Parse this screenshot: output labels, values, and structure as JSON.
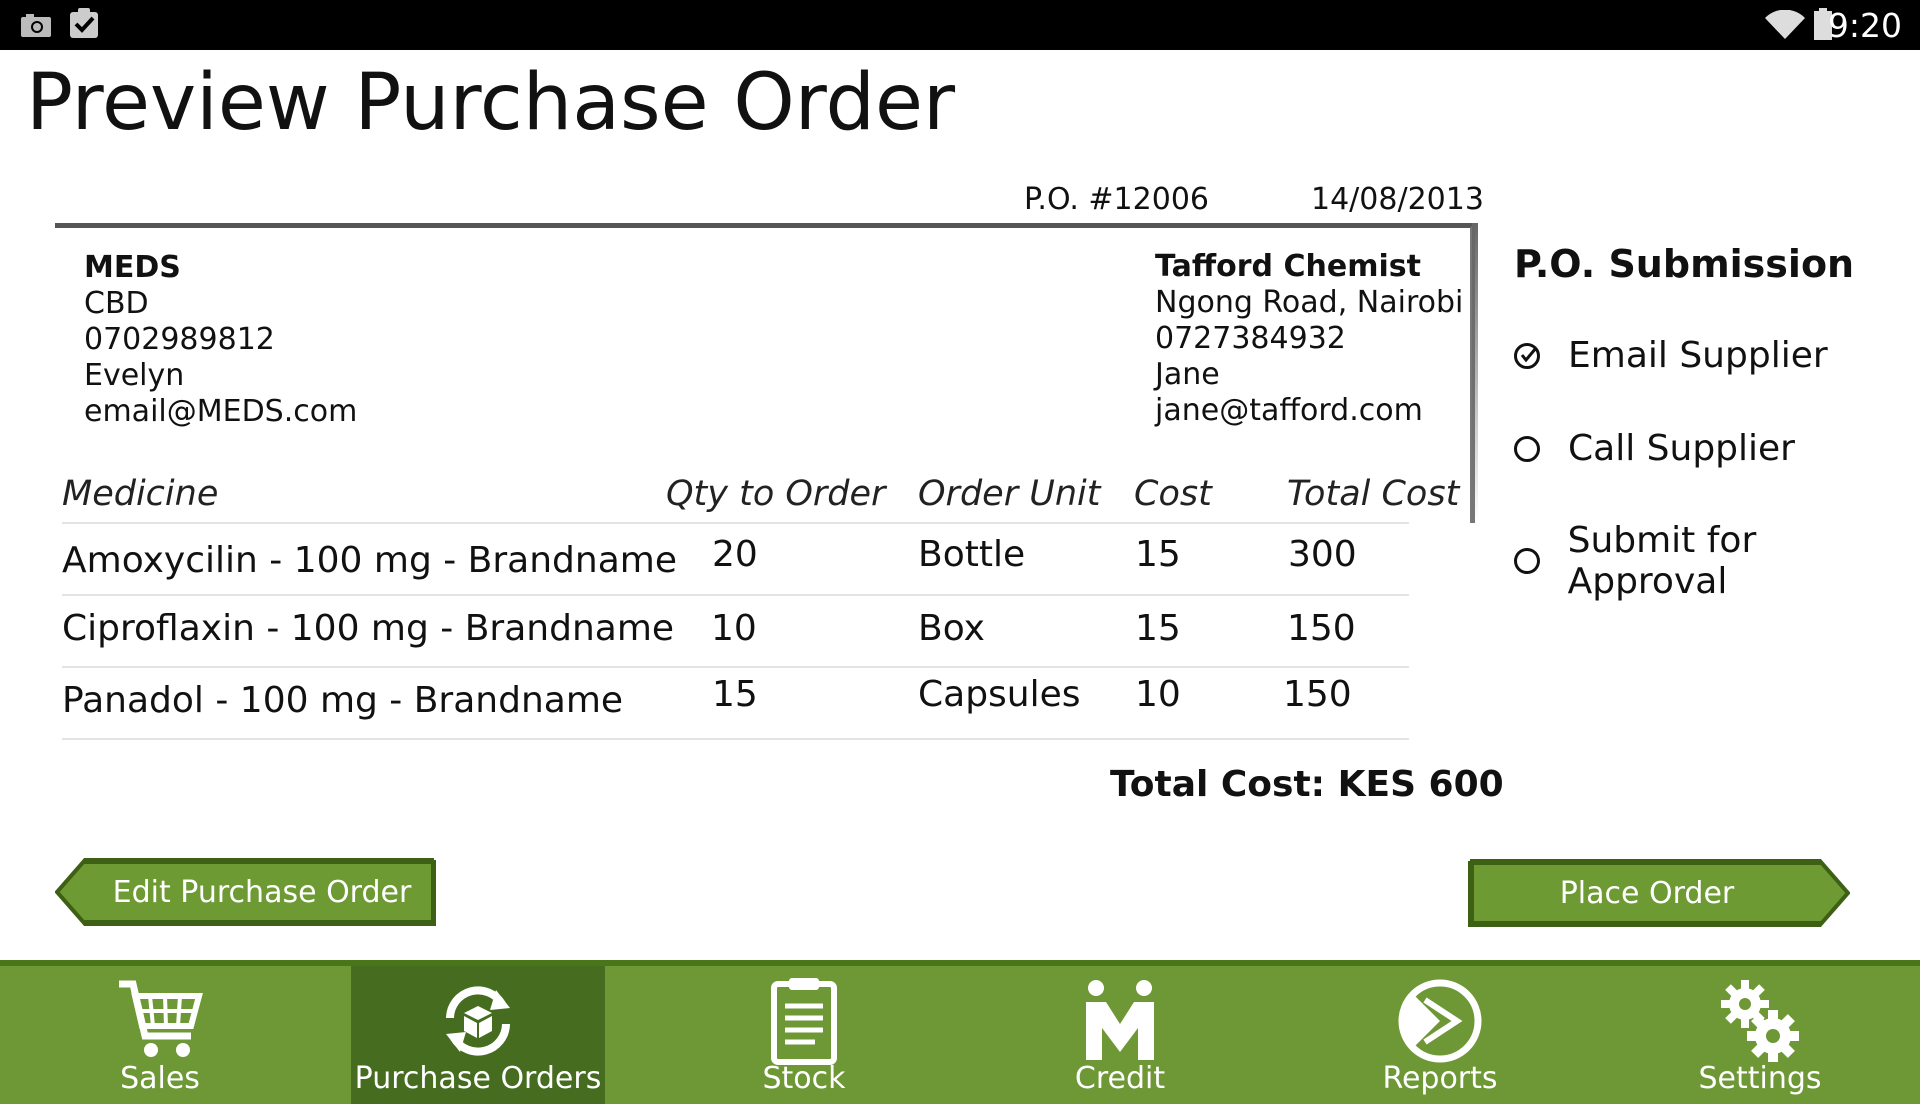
{
  "status_bar": {
    "time": "9:20",
    "icons": [
      "camera-icon",
      "clipboard-check-icon",
      "wifi-icon",
      "battery-icon"
    ]
  },
  "page": {
    "title": "Preview Purchase Order"
  },
  "order": {
    "po_number": "P.O. #12006",
    "date": "14/08/2013"
  },
  "buyer": {
    "name": "MEDS",
    "location": "CBD",
    "phone": "0702989812",
    "contact": "Evelyn",
    "email": "email@MEDS.com"
  },
  "supplier": {
    "name": "Tafford Chemist",
    "location": "Ngong Road, Nairobi",
    "phone": "0727384932",
    "contact": "Jane",
    "email": "jane@tafford.com"
  },
  "table": {
    "columns": [
      "Medicine",
      "Qty to Order",
      "Order Unit",
      "Cost",
      "Total Cost"
    ],
    "rows": [
      {
        "medicine": "Amoxycilin - 100 mg - Brandname",
        "qty": "20",
        "unit": "Bottle",
        "cost": "15",
        "total": "300"
      },
      {
        "medicine": "Ciproflaxin - 100 mg - Brandname",
        "qty": "10",
        "unit": "Box",
        "cost": "15",
        "total": "150"
      },
      {
        "medicine": "Panadol - 100 mg - Brandname",
        "qty": "15",
        "unit": "Capsules",
        "cost": "10",
        "total": "150"
      }
    ],
    "total_label": "Total Cost: KES 600"
  },
  "submission": {
    "title": "P.O. Submission",
    "options": [
      {
        "label": "Email Supplier",
        "selected": true
      },
      {
        "label": "Call Supplier",
        "selected": false
      },
      {
        "label": "Submit for Approval",
        "selected": false
      }
    ]
  },
  "actions": {
    "edit_label": "Edit Purchase Order",
    "place_label": "Place Order"
  },
  "nav": {
    "items": [
      {
        "label": "Sales",
        "icon": "cart-icon"
      },
      {
        "label": "Purchase Orders",
        "icon": "purchase-orders-icon",
        "active": true
      },
      {
        "label": "Stock",
        "icon": "clipboard-icon"
      },
      {
        "label": "Credit",
        "icon": "handshake-icon"
      },
      {
        "label": "Reports",
        "icon": "pie-chart-icon"
      },
      {
        "label": "Settings",
        "icon": "gears-icon"
      }
    ]
  },
  "colors": {
    "nav_bg": "#6e9735",
    "nav_active": "#466c1f",
    "button_bg": "#6e9a33",
    "button_border": "#3e6014"
  }
}
